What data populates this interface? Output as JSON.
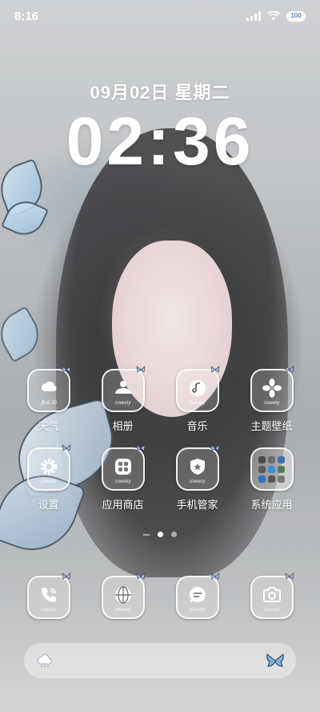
{
  "status_bar": {
    "time": "8:16",
    "battery": "100"
  },
  "lockscreen": {
    "date": "09月02日 星期二",
    "clock": "02:36"
  },
  "icon_signature": "Sweety",
  "weather_badge": "多云 30",
  "apps": [
    {
      "label": "天气",
      "icon": "weather-icon"
    },
    {
      "label": "相册",
      "icon": "gallery-icon"
    },
    {
      "label": "音乐",
      "icon": "music-icon"
    },
    {
      "label": "主题壁纸",
      "icon": "theme-icon"
    },
    {
      "label": "设置",
      "icon": "settings-icon"
    },
    {
      "label": "应用商店",
      "icon": "app-store-icon"
    },
    {
      "label": "手机管家",
      "icon": "phone-manager-icon"
    },
    {
      "label": "系统应用",
      "icon": "system-apps-folder-icon"
    }
  ],
  "dock": [
    {
      "icon": "phone-icon"
    },
    {
      "icon": "browser-icon"
    },
    {
      "icon": "messages-icon"
    },
    {
      "icon": "camera-icon"
    }
  ],
  "pages": {
    "count": 2,
    "current": 1
  },
  "search_bar": {
    "left_icon": "weather-cloud-icon",
    "right_icon": "butterfly-icon"
  },
  "colors": {
    "accent": "#ffffff",
    "wing": "#8fb5d4"
  }
}
